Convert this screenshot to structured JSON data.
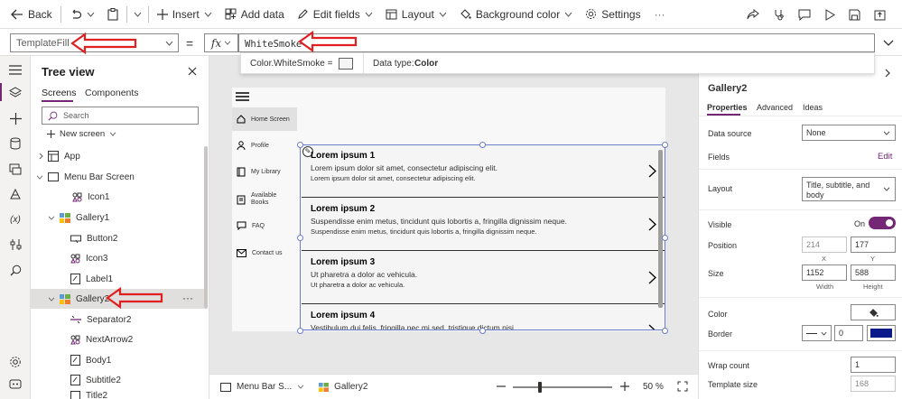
{
  "toolbar": {
    "back": "Back",
    "insert": "Insert",
    "add_data": "Add data",
    "edit_fields": "Edit fields",
    "layout": "Layout",
    "background_color": "Background color",
    "settings": "Settings"
  },
  "formula": {
    "property": "TemplateFill",
    "equals": "=",
    "fx": "fx",
    "value": "WhiteSmoke",
    "preview_value": "Color.WhiteSmoke  =",
    "data_type_label": "Data type:",
    "data_type": "Color"
  },
  "tree": {
    "title": "Tree view",
    "tabs": [
      "Screens",
      "Components"
    ],
    "search_placeholder": "Search",
    "new_screen": "New screen",
    "items": [
      {
        "label": "App"
      },
      {
        "label": "Menu Bar Screen"
      },
      {
        "label": "Icon1"
      },
      {
        "label": "Gallery1"
      },
      {
        "label": "Button2"
      },
      {
        "label": "Icon3"
      },
      {
        "label": "Label1"
      },
      {
        "label": "Gallery2"
      },
      {
        "label": "Separator2"
      },
      {
        "label": "NextArrow2"
      },
      {
        "label": "Body1"
      },
      {
        "label": "Subtitle2"
      },
      {
        "label": "Title2"
      }
    ]
  },
  "app_nav": [
    {
      "label": "Home Screen"
    },
    {
      "label": "Profile"
    },
    {
      "label": "My Library"
    },
    {
      "label": "Available Books"
    },
    {
      "label": "FAQ"
    },
    {
      "label": "Contact us"
    }
  ],
  "gallery": [
    {
      "title": "Lorem ipsum 1",
      "subtitle": "Lorem ipsum dolor sit amet, consectetur adipiscing elit.",
      "body": "Lorem ipsum dolor sit amet, consectetur adipiscing elit."
    },
    {
      "title": "Lorem ipsum 2",
      "subtitle": "Suspendisse enim metus, tincidunt quis lobortis a, fringilla dignissim neque.",
      "body": "Suspendisse enim metus, tincidunt quis lobortis a, fringilla dignissim neque."
    },
    {
      "title": "Lorem ipsum 3",
      "subtitle": "Ut pharetra a dolor ac vehicula.",
      "body": "Ut pharetra a dolor ac vehicula."
    },
    {
      "title": "Lorem ipsum 4",
      "subtitle": "Vestibulum dui felis, fringilla nec mi sed, tristique dictum nisi.",
      "body": ""
    }
  ],
  "bottom": {
    "screen_tab": "Menu Bar S...",
    "gallery_tab": "Gallery2",
    "zoom": "50",
    "zoom_unit": "%"
  },
  "props": {
    "name": "Gallery2",
    "tabs": [
      "Properties",
      "Advanced",
      "Ideas"
    ],
    "data_source_label": "Data source",
    "data_source": "None",
    "fields_label": "Fields",
    "fields_edit": "Edit",
    "layout_label": "Layout",
    "layout_value": "Title, subtitle, and body",
    "visible_label": "Visible",
    "visible_value": "On",
    "position_label": "Position",
    "position_x": "214",
    "position_y": "177",
    "x_label": "X",
    "y_label": "Y",
    "size_label": "Size",
    "width": "1152",
    "height": "588",
    "width_label": "Width",
    "height_label": "Height",
    "color_label": "Color",
    "border_label": "Border",
    "border_width": "0",
    "border_color": "#0b1a8a",
    "wrap_count_label": "Wrap count",
    "wrap_count": "1",
    "template_size_label": "Template size",
    "template_size": "168"
  },
  "colors": {
    "accent": "#742774",
    "annotation": "#e02020"
  }
}
